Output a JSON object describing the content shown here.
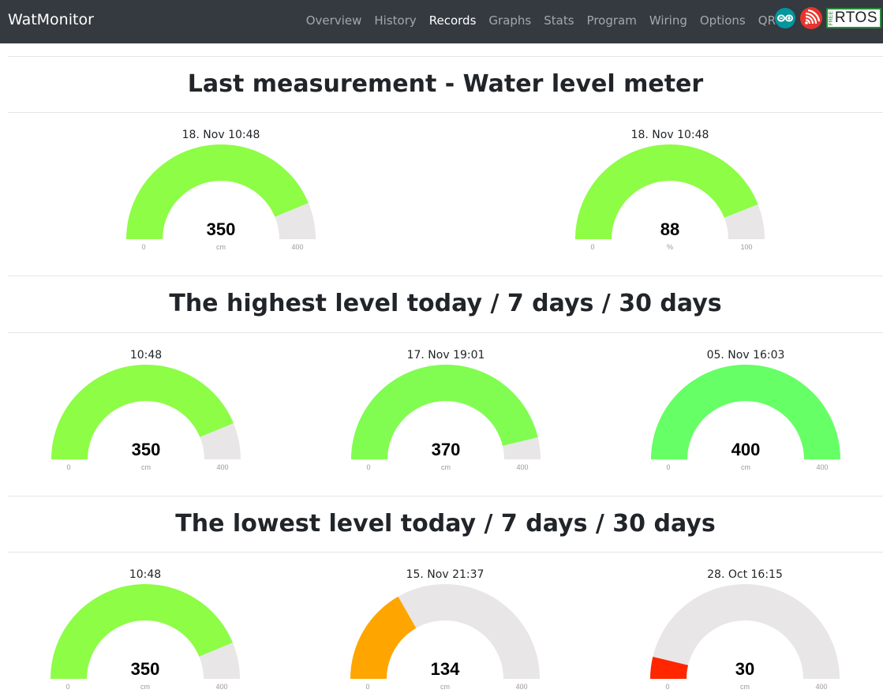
{
  "app": {
    "brand": "WatMonitor"
  },
  "nav": {
    "items": [
      {
        "label": "Overview",
        "active": false
      },
      {
        "label": "History",
        "active": false
      },
      {
        "label": "Records",
        "active": true
      },
      {
        "label": "Graphs",
        "active": false
      },
      {
        "label": "Stats",
        "active": false
      },
      {
        "label": "Program",
        "active": false
      },
      {
        "label": "Wiring",
        "active": false
      },
      {
        "label": "Options",
        "active": false
      },
      {
        "label": "QR",
        "active": false
      }
    ],
    "icons": [
      {
        "name": "arduino-icon"
      },
      {
        "name": "espressif-icon"
      },
      {
        "name": "freertos-logo",
        "free": "FREE",
        "text": "RTOS"
      }
    ]
  },
  "sections": [
    {
      "title": "Last measurement - Water level meter"
    },
    {
      "title": "The highest level today / 7 days / 30 days"
    },
    {
      "title": "The lowest level today / 7 days / 30 days"
    }
  ],
  "colors": {
    "track": "#e8e6e7",
    "navbar": "#343a40"
  },
  "gauges": [
    {
      "section": 0,
      "date": "18. Nov 10:48",
      "value": 350,
      "min": 0,
      "max": 400,
      "unit": "cm",
      "color": "#8dfd46"
    },
    {
      "section": 0,
      "date": "18. Nov 10:48",
      "value": 88,
      "min": 0,
      "max": 100,
      "unit": "%",
      "color": "#8dfd46"
    },
    {
      "section": 1,
      "date": "10:48",
      "value": 350,
      "min": 0,
      "max": 400,
      "unit": "cm",
      "color": "#8dfd46"
    },
    {
      "section": 1,
      "date": "17. Nov 19:01",
      "value": 370,
      "min": 0,
      "max": 400,
      "unit": "cm",
      "color": "#80fd50"
    },
    {
      "section": 1,
      "date": "05. Nov 16:03",
      "value": 400,
      "min": 0,
      "max": 400,
      "unit": "cm",
      "color": "#66ff66"
    },
    {
      "section": 2,
      "date": "10:48",
      "value": 350,
      "min": 0,
      "max": 400,
      "unit": "cm",
      "color": "#8dfd46"
    },
    {
      "section": 2,
      "date": "15. Nov 21:37",
      "value": 134,
      "min": 0,
      "max": 400,
      "unit": "cm",
      "color": "#ffa500"
    },
    {
      "section": 2,
      "date": "28. Oct 16:15",
      "value": 30,
      "min": 0,
      "max": 400,
      "unit": "cm",
      "color": "#ff2600"
    }
  ]
}
